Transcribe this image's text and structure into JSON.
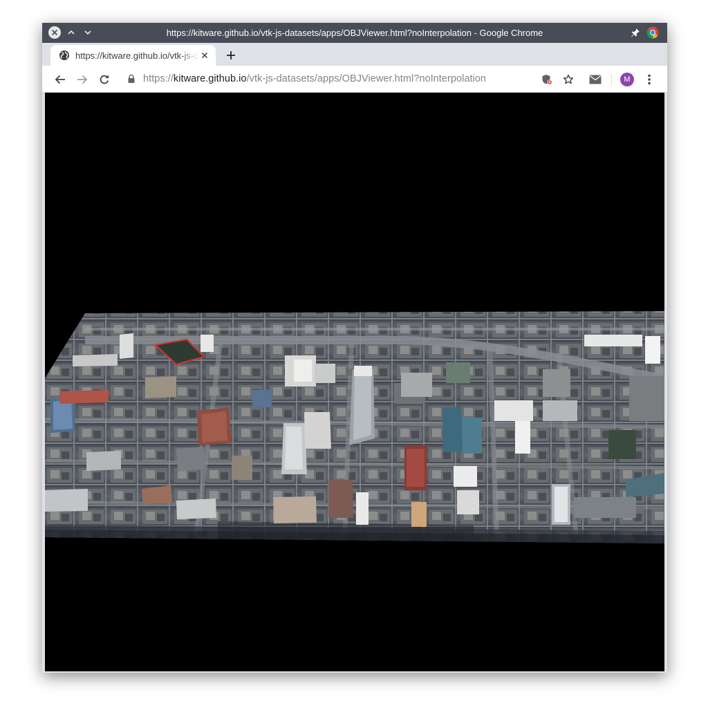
{
  "window": {
    "title": "https://kitware.github.io/vtk-js-datasets/apps/OBJViewer.html?noInterpolation - Google Chrome"
  },
  "tabs": [
    {
      "title": "https://kitware.github.io/vtk-js-datasets/apps/OBJViewer.html?noInterpolation",
      "favicon": "globe-icon",
      "active": true
    }
  ],
  "toolbar": {
    "url": {
      "scheme": "https://",
      "host": "kitware.github.io",
      "path": "/vtk-js-datasets/apps/OBJViewer.html?noInterpolation"
    },
    "avatar_letter": "M"
  },
  "colors": {
    "titlebar": "#474c57",
    "tabstrip": "#dee1e6",
    "avatar": "#8e44ad",
    "viewport_background": "#000000"
  }
}
